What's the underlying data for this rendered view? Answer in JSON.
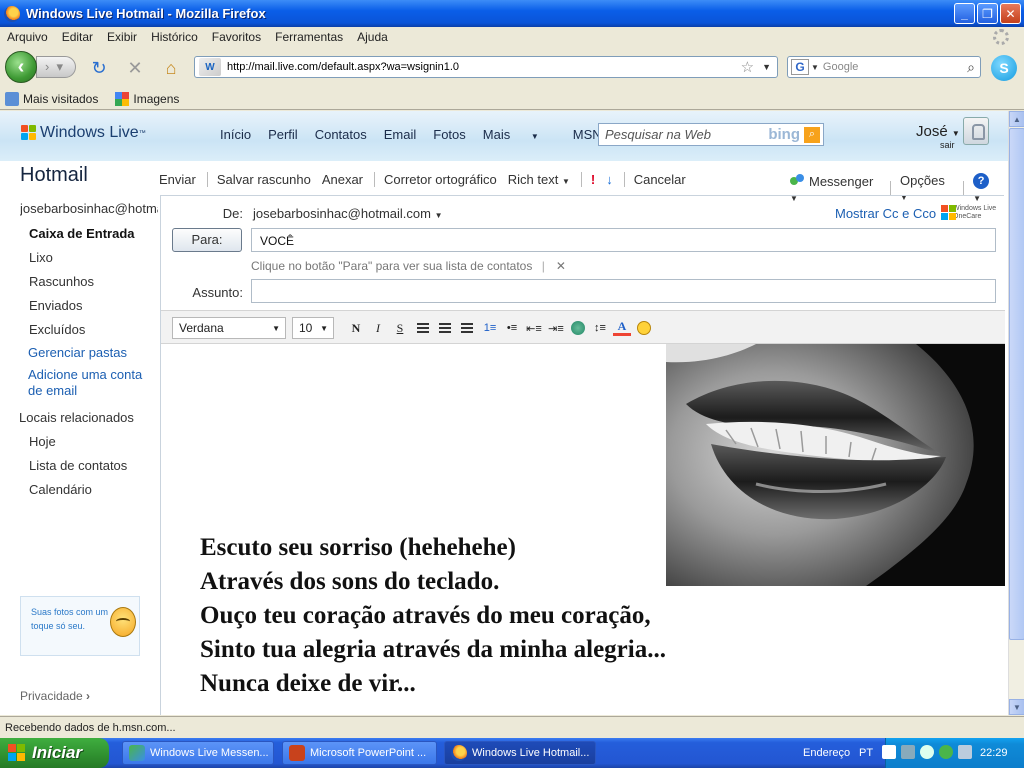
{
  "window": {
    "title": "Windows Live Hotmail - Mozilla Firefox"
  },
  "menu": [
    "Arquivo",
    "Editar",
    "Exibir",
    "Histórico",
    "Favoritos",
    "Ferramentas",
    "Ajuda"
  ],
  "nav": {
    "url": "http://mail.live.com/default.aspx?wa=wsignin1.0",
    "search_placeholder": "Google"
  },
  "bookmarks": [
    "Mais visitados",
    "Imagens"
  ],
  "wl": {
    "logo": "Windows Live",
    "nav": [
      "Início",
      "Perfil",
      "Contatos",
      "Email",
      "Fotos",
      "Mais",
      "MSN"
    ],
    "search_placeholder": "Pesquisar na Web",
    "bing": "bing",
    "user": "José",
    "signout": "sair"
  },
  "hotmail": {
    "title": "Hotmail",
    "toolbar": [
      "Enviar",
      "Salvar rascunho",
      "Anexar",
      "Corretor ortográfico",
      "Rich text",
      "Cancelar"
    ],
    "toolbar_right": [
      "Messenger",
      "Opções"
    ],
    "help": "?"
  },
  "sidebar": {
    "account": "josebarbosinhac@hotmail.com",
    "folders": [
      "Caixa de Entrada",
      "Lixo",
      "Rascunhos",
      "Enviados",
      "Excluídos"
    ],
    "manage": "Gerenciar pastas",
    "add_account": "Adicione uma conta de email",
    "related_title": "Locais relacionados",
    "related": [
      "Hoje",
      "Lista de contatos",
      "Calendário"
    ],
    "promo": "Suas fotos com um toque só seu.",
    "privacy": "Privacidade"
  },
  "compose": {
    "from_label": "De:",
    "from_value": "josebarbosinhac@hotmail.com",
    "show_cc": "Mostrar Cc e Cco",
    "onecare": "Windows Live OneCare",
    "to_button": "Para:",
    "to_value": "VOCÊ",
    "hint": "Clique no botão \"Para\" para ver sua lista de contatos",
    "subject_label": "Assunto:",
    "subject_value": "",
    "font": "Verdana",
    "size": "10",
    "poem": [
      "Escuto seu sorriso (hehehehe)",
      "Através dos sons do teclado.",
      "Ouço teu coração através do meu coração,",
      "Sinto tua alegria através da minha alegria...",
      "Nunca deixe de vir..."
    ]
  },
  "status": "Recebendo dados de h.msn.com...",
  "taskbar": {
    "start": "Iniciar",
    "tasks": [
      "Windows Live Messen...",
      "Microsoft PowerPoint ...",
      "Windows Live Hotmail..."
    ],
    "address": "Endereço",
    "lang": "PT",
    "clock": "22:29"
  }
}
